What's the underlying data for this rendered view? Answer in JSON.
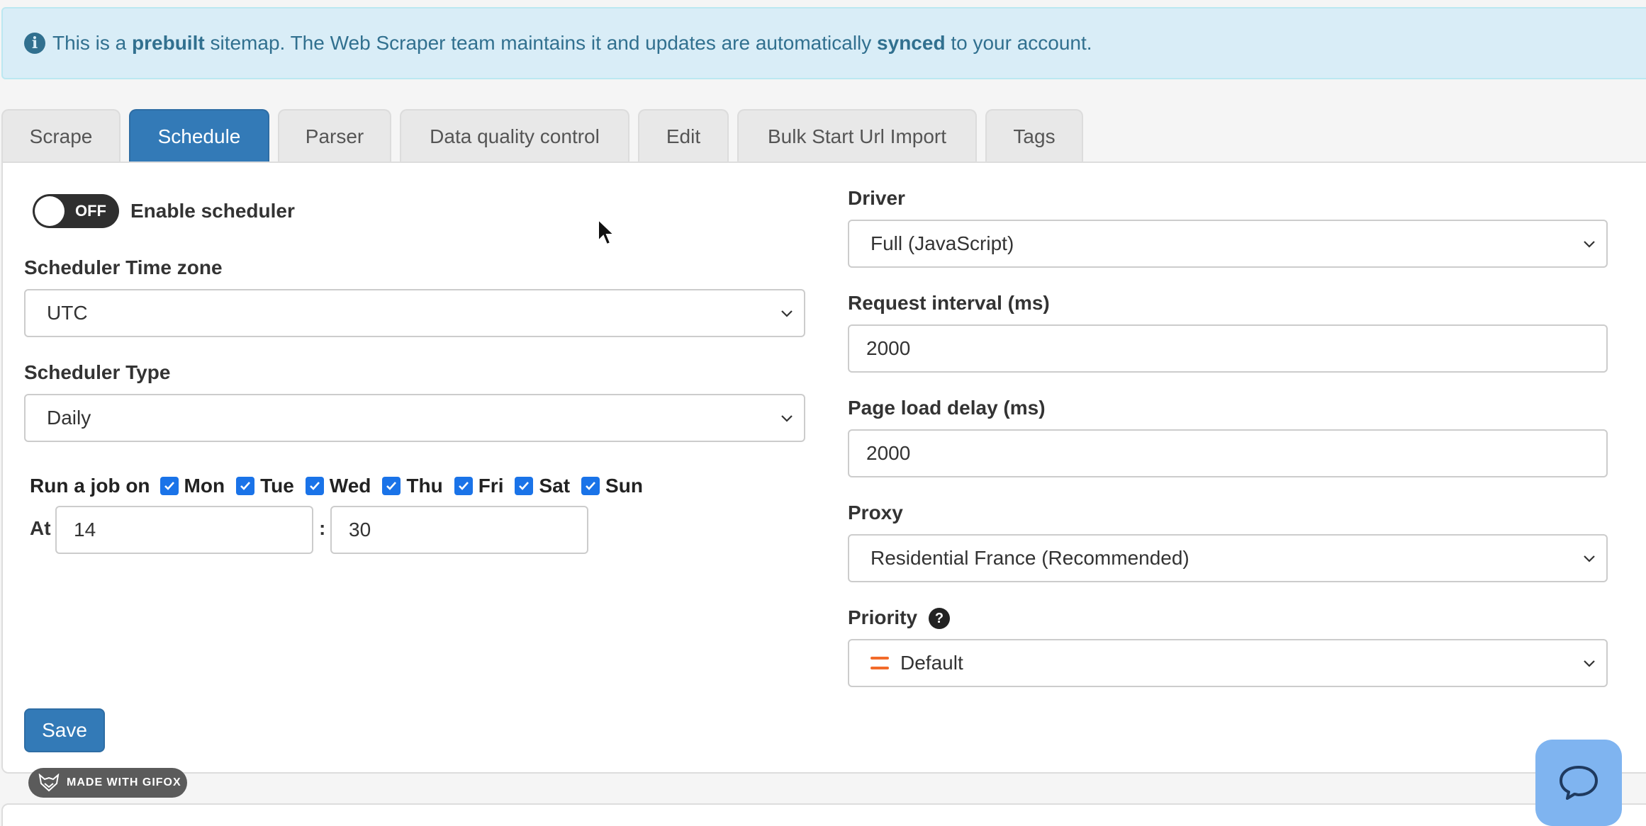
{
  "alert": {
    "prefix": "This is a ",
    "bold1": "prebuilt",
    "middle": " sitemap. The Web Scraper team maintains it and updates are automatically ",
    "bold2": "synced",
    "suffix": " to your account."
  },
  "tabs": [
    {
      "label": "Scrape",
      "active": false
    },
    {
      "label": "Schedule",
      "active": true
    },
    {
      "label": "Parser",
      "active": false
    },
    {
      "label": "Data quality control",
      "active": false
    },
    {
      "label": "Edit",
      "active": false
    },
    {
      "label": "Bulk Start Url Import",
      "active": false
    },
    {
      "label": "Tags",
      "active": false
    }
  ],
  "scheduler": {
    "toggle_state": "OFF",
    "enable_label": "Enable scheduler",
    "timezone_label": "Scheduler Time zone",
    "timezone_value": "UTC",
    "type_label": "Scheduler Type",
    "type_value": "Daily",
    "run_label": "Run a job on",
    "days": [
      {
        "label": "Mon",
        "checked": true
      },
      {
        "label": "Tue",
        "checked": true
      },
      {
        "label": "Wed",
        "checked": true
      },
      {
        "label": "Thu",
        "checked": true
      },
      {
        "label": "Fri",
        "checked": true
      },
      {
        "label": "Sat",
        "checked": true
      },
      {
        "label": "Sun",
        "checked": true
      }
    ],
    "at_label": "At",
    "hour": "14",
    "separator": ":",
    "minute": "30",
    "save_label": "Save"
  },
  "settings": {
    "driver_label": "Driver",
    "driver_value": "Full (JavaScript)",
    "request_interval_label": "Request interval (ms)",
    "request_interval_value": "2000",
    "page_load_delay_label": "Page load delay (ms)",
    "page_load_delay_value": "2000",
    "proxy_label": "Proxy",
    "proxy_value": "Residential France (Recommended)",
    "priority_label": "Priority",
    "priority_help": "?",
    "priority_value": "Default"
  },
  "badge": {
    "text": "MADE WITH GIFOX"
  },
  "colors": {
    "primary": "#337ab7",
    "alert_bg": "#d9edf7",
    "alert_text": "#31708f",
    "checkbox": "#1a73e8",
    "priority_icon": "#f26b2a",
    "chat": "#7fb4f0"
  }
}
